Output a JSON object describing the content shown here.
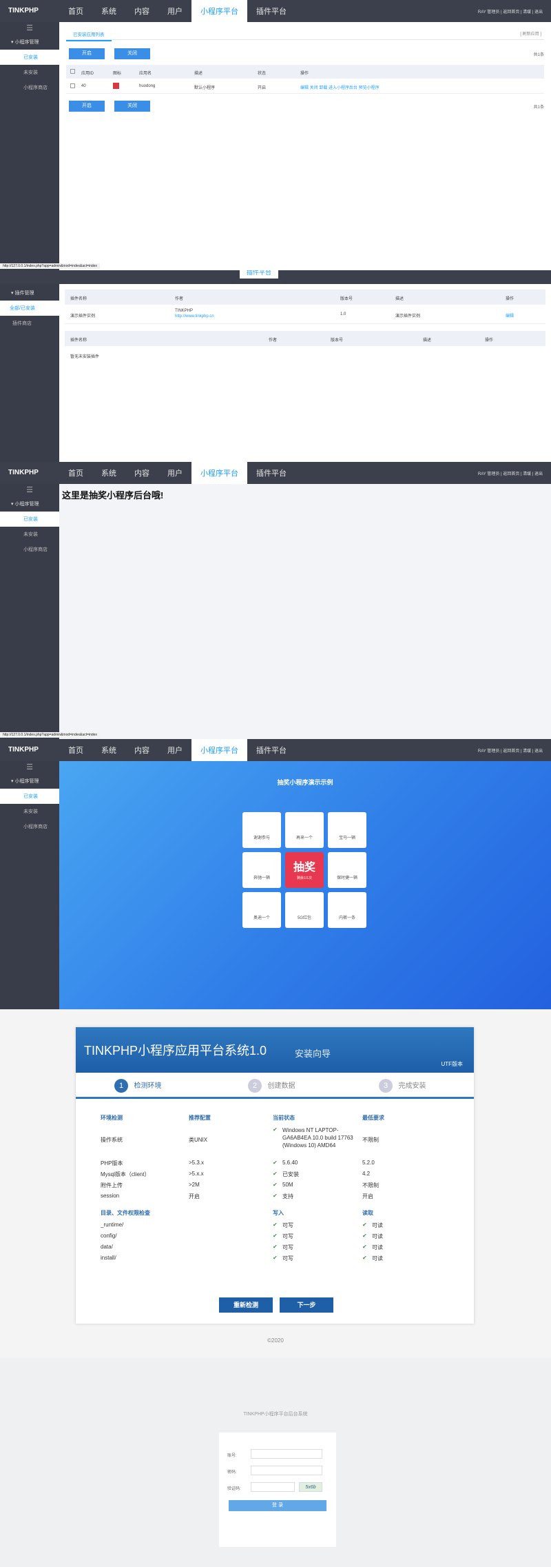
{
  "topbar": {
    "logo": "TINKPHP",
    "nav": [
      "首页",
      "系统",
      "内容",
      "用户",
      "小程序平台",
      "插件平台"
    ],
    "right": "RAY 管理员 | 返回首页 | 清缓 | 退出"
  },
  "sidebar": {
    "menu": "小程序管理",
    "installed": "已安装",
    "uninstalled": "未安装",
    "store": "小程序商店"
  },
  "p1": {
    "tab": "已安装应用列表",
    "tab_right": "[ 刷新应用 ]",
    "btn_on": "开启",
    "btn_off": "关闭",
    "count": "共1条",
    "headers": [
      "应用ID",
      "图标",
      "应用名",
      "描述",
      "状态",
      "操作"
    ],
    "row": {
      "id": "40",
      "name": "huodong",
      "desc": "默认小程序",
      "status": "开启",
      "ops": "编辑 关闭 卸载 进入小程序后台 预览小程序"
    },
    "count2": "共1条",
    "url": "http://127.0.0.1/index.php?app=admin&mod=index&act=index"
  },
  "p2": {
    "nav_plugin": "插件平台",
    "menu": "插件管理",
    "installed": "全部/已安装",
    "store": "插件商店",
    "headers": [
      "插件名称",
      "作者",
      "版本号",
      "描述",
      "操作"
    ],
    "row": {
      "name": "演示插件实例",
      "author": "TINKPHP",
      "author_url": "http://www.tinkphp.cn",
      "ver": "1.0",
      "desc": "演示插件实例",
      "op": "编辑"
    },
    "headers2": [
      "插件名称",
      "作者",
      "版本号",
      "描述",
      "操作"
    ],
    "empty": "暂无未安装插件"
  },
  "p3": {
    "heading": "这里是抽奖小程序后台哦!",
    "url": "http://127.0.0.1/index.php?app=admin&mod=index&act=index"
  },
  "p4": {
    "title": "抽奖小程序演示示例",
    "cells": [
      "谢谢参与",
      "再来一个",
      "宝马一辆",
      "抽奖",
      "奔驰一辆",
      "保时捷一辆",
      "奥迪一个",
      "5G红包",
      "内裤一条"
    ],
    "center_sub": "剩余1/1次"
  },
  "p5": {
    "title": "TINKPHP小程序应用平台系统1.0",
    "subtitle": "安装向导",
    "charset": "UTF版本",
    "steps": [
      {
        "num": "1",
        "label": "检测环境"
      },
      {
        "num": "2",
        "label": "创建数据"
      },
      {
        "num": "3",
        "label": "完成安装"
      }
    ],
    "env_headers": [
      "环境检测",
      "推荐配置",
      "当前状态",
      "最低要求"
    ],
    "env_rows": [
      [
        "操作系统",
        "类UNIX",
        "Windows NT LAPTOP-GA6AB4EA 10.0 build 17763 (Windows 10) AMD64",
        "不限制"
      ],
      [
        "PHP版本",
        ">5.3.x",
        "5.6.40",
        "5.2.0"
      ],
      [
        "Mysql版本（client）",
        ">5.x.x",
        "已安装",
        "4.2"
      ],
      [
        "附件上传",
        ">2M",
        "50M",
        "不限制"
      ],
      [
        "session",
        "开启",
        "支持",
        "开启"
      ]
    ],
    "dir_headers": [
      "目录、文件权限检查",
      "写入",
      "读取"
    ],
    "dir_rows": [
      [
        "_runtime/",
        "可写",
        "可读"
      ],
      [
        "config/",
        "可写",
        "可读"
      ],
      [
        "data/",
        "可写",
        "可读"
      ],
      [
        "install/",
        "可写",
        "可读"
      ]
    ],
    "btn_recheck": "重新检测",
    "btn_next": "下一步",
    "footer": "©2020"
  },
  "p6": {
    "title": "TINKPHP小程序平台后台系统",
    "user_label": "账号:",
    "pass_label": "密码:",
    "code_label": "验证码:",
    "captcha": "5x6b",
    "submit": "登 录"
  },
  "colors": {
    "accent": "#1e9fff",
    "topbar": "#3b404c",
    "sidebar": "#393d49",
    "button": "#3a8ee6",
    "prize": "#e8384f"
  }
}
